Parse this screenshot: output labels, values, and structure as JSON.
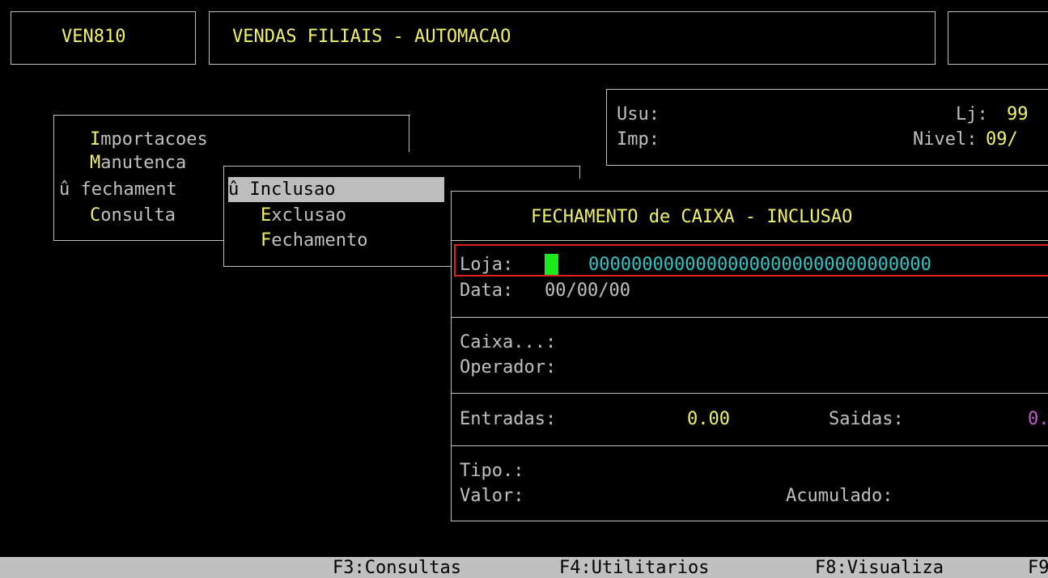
{
  "header": {
    "program_code": "VEN810",
    "program_title": "VENDAS FILIAIS - AUTOMACAO"
  },
  "info_panel": {
    "user_label": "Usu:",
    "store_label": "Lj:",
    "store_value": "99",
    "printer_label": "Imp:",
    "level_label": "Nivel:",
    "level_value": "09/"
  },
  "main_menu": {
    "items": [
      {
        "label": "Importacoes",
        "hotkey": "I",
        "rest": "mportacoes"
      },
      {
        "label": "Manutenca",
        "hotkey": "M",
        "rest": "anutenca"
      },
      {
        "label": "fechament",
        "marker": "û",
        "selected": true
      },
      {
        "label": "Consulta",
        "hotkey": "C",
        "rest": "onsulta"
      }
    ]
  },
  "sub_menu": {
    "items": [
      {
        "label": "Inclusao",
        "marker": "û",
        "selected": true
      },
      {
        "label": "Exclusao",
        "hotkey": "E",
        "rest": "xclusao"
      },
      {
        "label": "Fechamento",
        "hotkey": "F",
        "rest": "echamento"
      }
    ]
  },
  "form": {
    "title": "FECHAMENTO de CAIXA - INCLUSAO",
    "loja_label": "Loja:",
    "loja_value": "00000000000000000000000000000000",
    "data_label": "Data:",
    "data_value": "00/00/00",
    "caixa_label": "Caixa...:",
    "operador_label": "Operador:",
    "entradas_label": "Entradas:",
    "entradas_value": "0.00",
    "saidas_label": "Saidas:",
    "saidas_value": "0.",
    "tipo_label": "Tipo.:",
    "valor_label": "Valor:",
    "acumulado_label": "Acumulado:"
  },
  "status_bar": {
    "f3": "F3:Consultas",
    "f4": "F4:Utilitarios",
    "f8": "F8:Visualiza",
    "f9": "F9"
  },
  "colors": {
    "background": "#000000",
    "text": "#c0c0c0",
    "accent_yellow": "#f2f26a",
    "accent_cyan": "#2fc6c6",
    "accent_magenta": "#c060c8",
    "cursor_green": "#1ee81e",
    "focus_red": "#e02020"
  }
}
